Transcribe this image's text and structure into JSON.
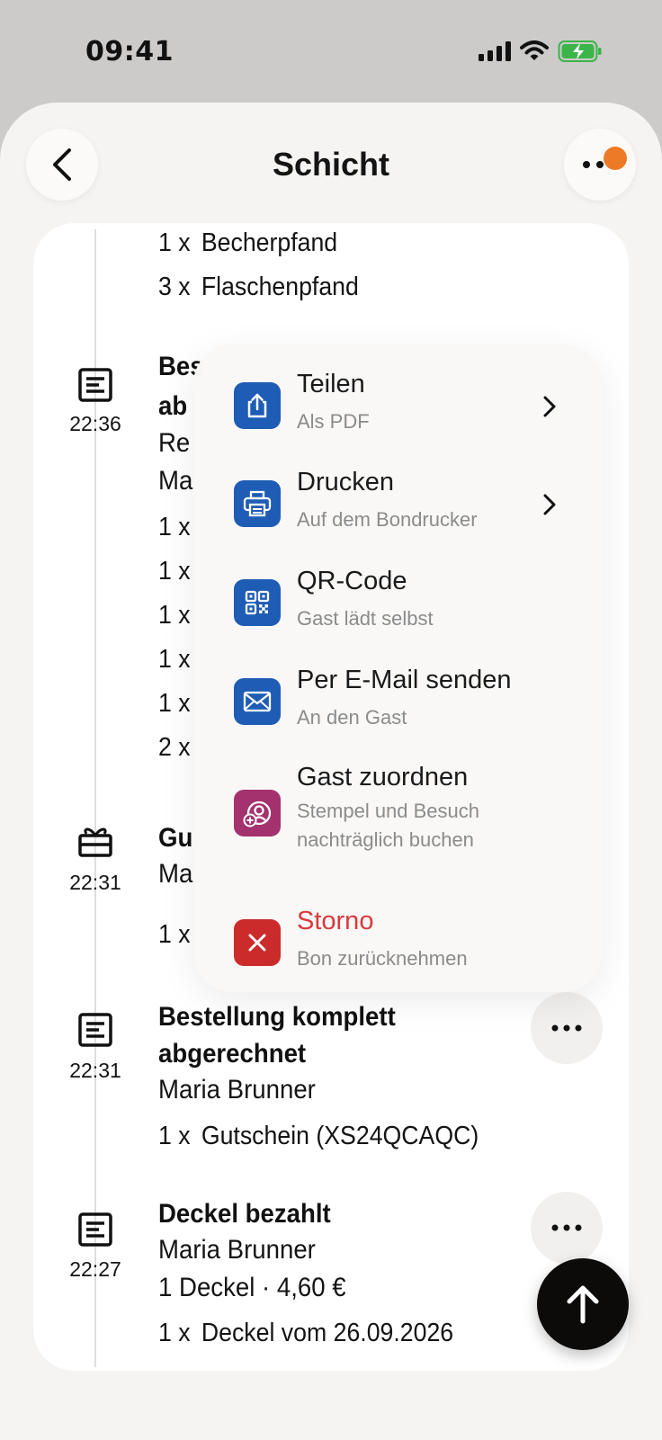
{
  "status_bar": {
    "time": "09:41"
  },
  "header": {
    "title": "Schicht"
  },
  "timeline": {
    "top_items": [
      {
        "qty": "1 x",
        "name": "Becherpfand"
      },
      {
        "qty": "3 x",
        "name": "Flaschenpfand"
      }
    ],
    "event1": {
      "time": "22:36",
      "title_partial": "Bes",
      "title_partial2": "ab",
      "sub1": "Re",
      "sub2": "Ma",
      "qtys": [
        "1 x",
        "1 x",
        "1 x",
        "1 x",
        "1 x",
        "2 x"
      ]
    },
    "event2": {
      "time": "22:31",
      "title_partial": "Gu",
      "sub": "Ma",
      "qty": "1 x"
    },
    "event3": {
      "time": "22:31",
      "title_line1": "Bestellung komplett",
      "title_line2": "abgerechnet",
      "person": "Maria Brunner",
      "qty": "1 x",
      "item": "Gutschein (XS24QCAQC)"
    },
    "event4": {
      "time": "22:27",
      "title": "Deckel bezahlt",
      "person": "Maria Brunner",
      "summary": "1 Deckel · 4,60 €",
      "qty": "1 x",
      "item": "Deckel vom 26.09.2026"
    }
  },
  "menu": {
    "items": [
      {
        "label": "Teilen",
        "sub": "Als PDF",
        "icon": "share-icon",
        "color": "#1f5cb5"
      },
      {
        "label": "Drucken",
        "sub": "Auf dem Bondrucker",
        "icon": "printer-icon",
        "color": "#1f5cb5"
      },
      {
        "label": "QR-Code",
        "sub": "Gast lädt selbst",
        "icon": "qr-code-icon",
        "color": "#1f5cb5"
      },
      {
        "label": "Per E-Mail senden",
        "sub": "An den Gast",
        "icon": "mail-icon",
        "color": "#1f5cb5"
      },
      {
        "label": "Gast zuordnen",
        "sub": "Stempel und Besuch nachträglich buchen",
        "icon": "guest-add-icon",
        "color": "#a3326f"
      },
      {
        "label": "Storno",
        "sub": "Bon zurücknehmen",
        "icon": "cancel-icon",
        "color": "#cc2b2b",
        "label_color": "#d83a3a"
      }
    ]
  }
}
